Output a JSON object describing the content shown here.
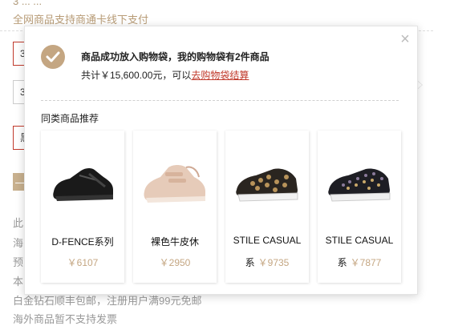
{
  "background": {
    "top_line": "3 ... ...",
    "notice": "全网商品支持商通卡线下支付",
    "box1": "3",
    "box2": "3",
    "box3": "黑",
    "minus": "—",
    "lines": [
      "此",
      "海",
      "预",
      "本",
      "白金钻石顺丰包邮，注册用户满99元免邮",
      "海外商品暂不支持发票"
    ]
  },
  "popup": {
    "close": "×",
    "success": "商品成功放入购物袋，我的购物袋有2件商品",
    "total_prefix": "共计￥15,600.00元，可以",
    "checkout_link": "去购物袋结算",
    "rec_title": "同类商品推荐",
    "products": [
      {
        "name": "D-FENCE系列",
        "name_cont": "",
        "price": "￥6107",
        "shoe": "black-sneaker"
      },
      {
        "name": "裸色牛皮休",
        "name_cont": "",
        "price": "￥2950",
        "shoe": "nude-sneaker"
      },
      {
        "name": "STILE CASUAL",
        "name_cont": "系",
        "price": "￥9735",
        "shoe": "leopard-slipon"
      },
      {
        "name": "STILE CASUAL",
        "name_cont": "系",
        "price": "￥7877",
        "shoe": "sequin-slipon"
      }
    ]
  },
  "colors": {
    "accent": "#c4a682",
    "link": "#c0392b"
  }
}
